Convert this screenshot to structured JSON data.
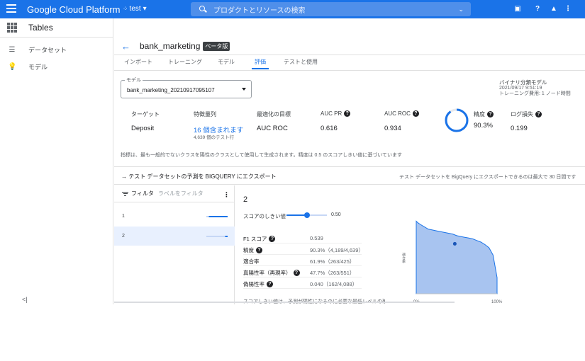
{
  "topbar": {
    "brand": "Google Cloud Platform",
    "project": "test",
    "search_placeholder": "プロダクトとリソースの検索",
    "bg_color": "#1a73e8"
  },
  "leftnav": {
    "title": "Tables",
    "items": [
      {
        "label": "データセット",
        "icon": "dataset-icon"
      },
      {
        "label": "モデル",
        "icon": "model-icon"
      }
    ],
    "collapse": "<|"
  },
  "header": {
    "dataset": "bank_marketing",
    "badge": "ベータ版"
  },
  "tabs": [
    {
      "label": "インポート",
      "active": false
    },
    {
      "label": "トレーニング",
      "active": false
    },
    {
      "label": "モデル",
      "active": false
    },
    {
      "label": "評価",
      "active": true
    },
    {
      "label": "テストと使用",
      "active": false
    }
  ],
  "model_select": {
    "label": "モデル",
    "value": "bank_marketing_20210917095107"
  },
  "model_info": {
    "type": "バイナリ分類モデル",
    "date": "2021/09/17 9:51:19",
    "cost": "トレーニング費用: 1 ノード時間"
  },
  "metrics": {
    "target_label": "ターゲット",
    "target_value": "Deposit",
    "features_label": "特徴量列",
    "features_value": "16 個含まれます",
    "features_sub": "4,639 個のテスト行",
    "objective_label": "最適化の目標",
    "objective_value": "AUC ROC",
    "aucpr_label": "AUC PR",
    "aucpr_value": "0.616",
    "aucroc_label": "AUC ROC",
    "aucroc_value": "0.934",
    "precision_label": "精度",
    "precision_value": "90.3%",
    "precision_fraction": 0.903,
    "logloss_label": "ログ損失",
    "logloss_value": "0.199"
  },
  "footnote": "指標は、最も一般的でないクラスを陽性のクラスとして使用して生成されます。精度は 0.5 のスコアしきい値に基づいています",
  "export": {
    "label": "テスト データセットの予測を BIGQUERY にエクスポート",
    "note": "テスト データセットを BigQuery にエクスポートできるのは最大で 30 日間です"
  },
  "filter": {
    "label": "フィルタ",
    "placeholder": "ラベルをフィルタ",
    "rows": [
      {
        "label": "1",
        "share": 0.89
      },
      {
        "label": "2",
        "share": 0.11
      }
    ]
  },
  "detail": {
    "title": "2",
    "threshold_label": "スコアのしきい値",
    "threshold_value": "0.50",
    "threshold_fraction": 0.5,
    "rows": [
      {
        "key": "F1 スコア",
        "value": "0.539"
      },
      {
        "key": "精度",
        "value": "90.3%（4,189/4,639）"
      },
      {
        "key": "適合率",
        "value": "61.9%（263/425）"
      },
      {
        "key": "真陽性率（再現率）",
        "value": "47.7%（263/551）"
      },
      {
        "key": "偽陽性率",
        "value": "0.040（162/4,088）"
      }
    ],
    "cut_note": "スコアしきい値は、予測が陽性になるのに必要な最低レベルの確"
  },
  "chart_data": {
    "type": "area",
    "ylabel": "適合率",
    "x_ticks": [
      "0%",
      "100%"
    ],
    "x": [
      0,
      0.02,
      0.05,
      0.1,
      0.15,
      0.2,
      0.25,
      0.3,
      0.35,
      0.4,
      0.45,
      0.5,
      0.55,
      0.6,
      0.65,
      0.7,
      0.75,
      0.8,
      0.85,
      0.9,
      0.95,
      1.0
    ],
    "y": [
      0.9,
      0.88,
      0.86,
      0.83,
      0.8,
      0.79,
      0.78,
      0.77,
      0.76,
      0.75,
      0.74,
      0.72,
      0.71,
      0.7,
      0.69,
      0.68,
      0.66,
      0.64,
      0.61,
      0.57,
      0.48,
      0.2
    ],
    "highlight": {
      "x": 0.477,
      "y": 0.619
    },
    "color": "#1a73e8"
  }
}
